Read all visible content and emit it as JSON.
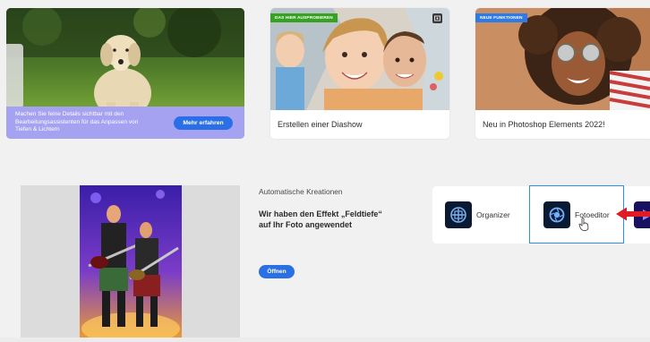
{
  "promo_card": {
    "text": "Machen Sie feine Details sichtbar mit den Bearbeitungsassistenten für das Anpassen von Tiefen & Lichtern",
    "button_label": "Mehr erfahren"
  },
  "feature_cards": [
    {
      "badge": "DAS HIER AUSPROBIEREN",
      "caption": "Erstellen einer Diashow",
      "badge_color": "#35a321"
    },
    {
      "badge": "NEUE FUNKTIONEN",
      "caption": "Neu in Photoshop Elements 2022!",
      "badge_color": "#2d7be8"
    }
  ],
  "auto_creations": {
    "label": "Automatische Kreationen",
    "heading": "Wir haben den Effekt „Feldtiefe“ auf Ihr Foto angewendet",
    "button_label": "Öffnen"
  },
  "app_switcher": {
    "apps": [
      {
        "label": "Organizer",
        "icon": "organizer-icon"
      },
      {
        "label": "Fotoeditor",
        "icon": "photo-editor-icon",
        "selected": true
      },
      {
        "label": "",
        "icon": "premiere-elements-icon"
      }
    ],
    "selected_border_color": "#2f8cf0"
  },
  "colors": {
    "accent_blue": "#2b6fe6",
    "promo_overlay": "#a6a2f2",
    "annotation_arrow": "#e01b24"
  }
}
